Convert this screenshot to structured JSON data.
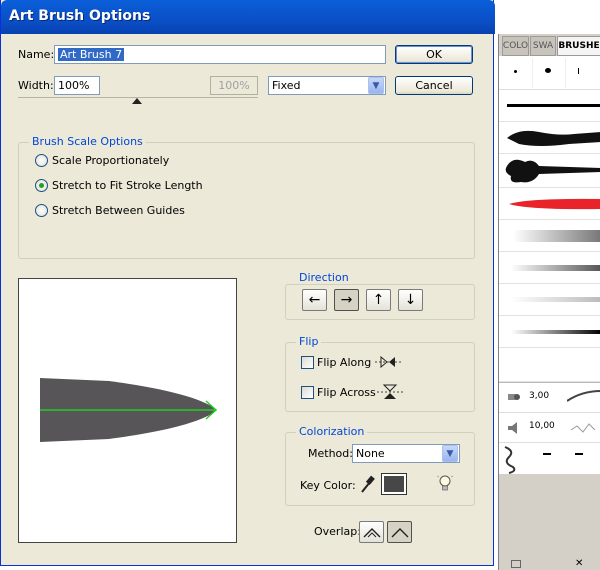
{
  "dialog": {
    "title": "Art Brush Options",
    "name_label": "Name:",
    "name_value": "Art Brush 7",
    "width_label": "Width:",
    "width_value": "100%",
    "width_disabled_value": "100%",
    "width_mode": "Fixed",
    "ok_label": "OK",
    "cancel_label": "Cancel",
    "brush_scale": {
      "legend": "Brush Scale Options",
      "options": [
        "Scale Proportionately",
        "Stretch to Fit Stroke Length",
        "Stretch Between Guides"
      ],
      "selected_index": 1
    },
    "direction": {
      "legend": "Direction",
      "arrows": [
        "←",
        "→",
        "↑",
        "↓"
      ],
      "selected_index": 1
    },
    "flip": {
      "legend": "Flip",
      "along": "Flip Along",
      "across": "Flip Across"
    },
    "colorization": {
      "legend": "Colorization",
      "method_label": "Method:",
      "method_value": "None",
      "key_color_label": "Key Color:",
      "key_color": "#474747"
    },
    "overlap_label": "Overlap:",
    "preview_fill": "#575558",
    "direction_line_color": "#22cc22"
  },
  "panel": {
    "tabs": [
      "COLO",
      "SWA",
      "BRUSHE"
    ],
    "pattern_values": [
      "3,00",
      "10,00"
    ]
  }
}
